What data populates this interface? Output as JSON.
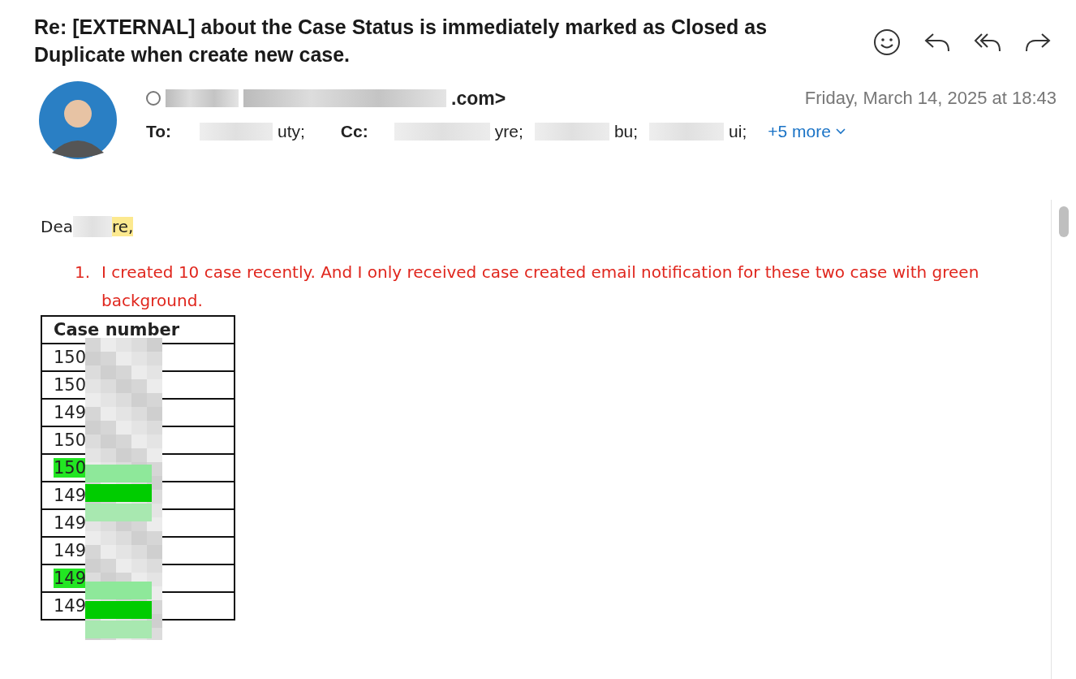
{
  "subject": "Re: [EXTERNAL] about the Case Status is immediately marked as Closed as Duplicate when create new case.",
  "sender": {
    "address_tail": ".com>"
  },
  "date": "Friday, March 14, 2025 at 18:43",
  "to": {
    "label": "To:",
    "recipients": [
      "uty;"
    ]
  },
  "cc": {
    "label": "Cc:",
    "recipients": [
      "yre;",
      "bu;",
      "ui;"
    ]
  },
  "more": "+5 more",
  "greeting": {
    "before": "Dea",
    "after": "re,"
  },
  "list": [
    {
      "number": "1.",
      "text": "I  created 10 case recently. And I only received case created email notification for these two case with green background."
    }
  ],
  "table": {
    "header": "Case number",
    "rows": [
      {
        "text": "150",
        "highlighted": false
      },
      {
        "text": "150",
        "highlighted": false
      },
      {
        "text": "149",
        "highlighted": false
      },
      {
        "text": "150",
        "highlighted": false
      },
      {
        "text": "150",
        "highlighted": true
      },
      {
        "text": "149",
        "highlighted": false
      },
      {
        "text": "149",
        "highlighted": false
      },
      {
        "text": "149",
        "highlighted": false
      },
      {
        "text": "149",
        "highlighted": true
      },
      {
        "text": "149",
        "highlighted": false
      }
    ]
  }
}
